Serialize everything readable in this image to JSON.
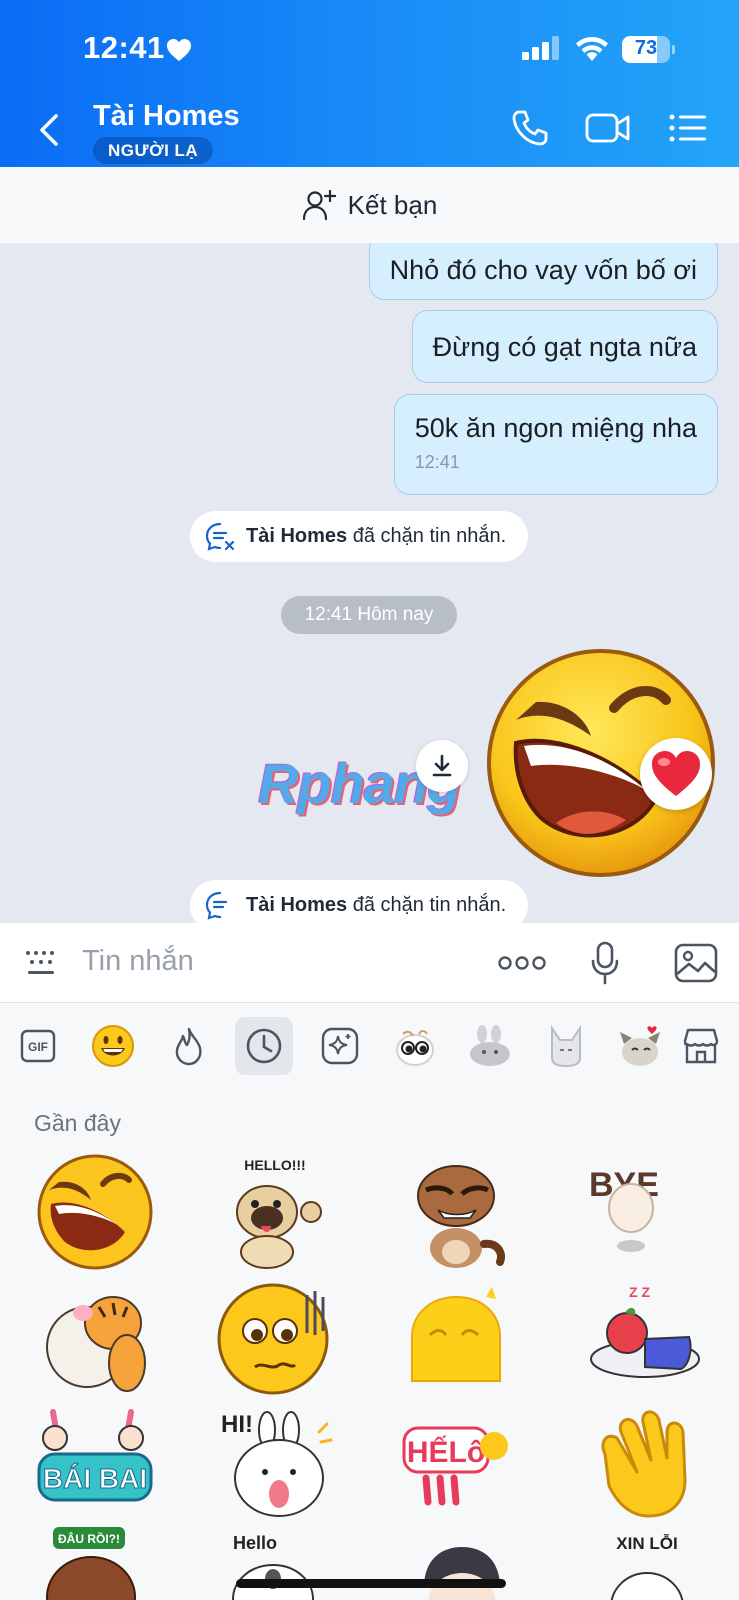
{
  "status_bar": {
    "time": "12:41",
    "battery_level": "73",
    "battery_fraction": 0.73
  },
  "header": {
    "contact_name": "Tài Homes",
    "stranger_label": "NGƯỜI LẠ"
  },
  "friend_bar": {
    "label": "Kết bạn"
  },
  "messages": [
    {
      "text": "Nhỏ đó cho vay vốn bố ơi"
    },
    {
      "text": "Đừng có gạt ngta nữa"
    },
    {
      "text": "50k ăn ngon miệng nha",
      "time": "12:41"
    }
  ],
  "system_notice": {
    "name": "Tài Homes",
    "text": " đã chặn tin nhắn."
  },
  "date_separator": "12:41 Hôm nay",
  "watermark": "Rphang",
  "composer": {
    "placeholder": "Tin nhắn"
  },
  "sticker_tabs": {
    "gif_label": "GIF"
  },
  "sticker_panel": {
    "section_title": "Gần đây",
    "sticker_texts": {
      "hello": "HELLO!!!",
      "bye": "BYE",
      "hi": "HI!",
      "bai_bai": "BÁI BAI",
      "hello_hey": "HẾLô",
      "dau_roi": "ĐÂU RỒI?!",
      "hello2": "Hello",
      "xin_loi": "XIN LỖI"
    }
  },
  "colors": {
    "header_start": "#0a6cf5",
    "header_end": "#23a4f8",
    "bubble": "#d5efff",
    "chat_bg": "#e4e8f0"
  }
}
